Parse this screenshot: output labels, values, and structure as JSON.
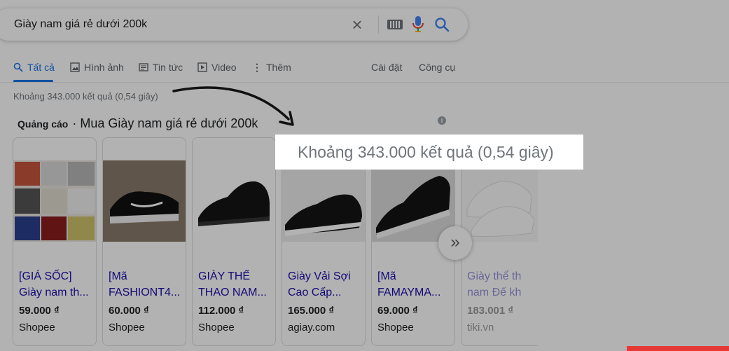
{
  "search": {
    "query": "Giày nam giá rẻ dưới 200k",
    "clear_icon": "close-icon",
    "keyboard_icon": "keyboard-icon",
    "mic_icon": "mic-icon",
    "search_icon": "search-icon"
  },
  "tabs": [
    {
      "label": "Tất cả",
      "icon": "search-icon",
      "active": true
    },
    {
      "label": "Hình ảnh",
      "icon": "image-icon"
    },
    {
      "label": "Tin tức",
      "icon": "news-icon"
    },
    {
      "label": "Video",
      "icon": "video-icon"
    },
    {
      "label": "Thêm",
      "icon": "more-vert-icon"
    },
    {
      "label": "Cài đặt"
    },
    {
      "label": "Công cụ"
    }
  ],
  "result_count": "Khoảng 343.000 kết quả (0,54 giây)",
  "ads": {
    "label": "Quảng cáo",
    "title": "· Mua Giày nam giá rẻ dưới 200k"
  },
  "products": [
    {
      "title_line1": "[GIÁ SỐC]",
      "title_line2": "Giày nam th...",
      "price": "59.000 ₫",
      "store": "Shopee"
    },
    {
      "title_line1": "[Mã",
      "title_line2": "FASHIONT4...",
      "price": "60.000 ₫",
      "store": "Shopee"
    },
    {
      "title_line1": "GIÀY THỂ",
      "title_line2": "THAO NAM...",
      "price": "112.000 ₫",
      "store": "Shopee"
    },
    {
      "title_line1": "Giày Vải Sợi",
      "title_line2": "Cao Cấp...",
      "price": "165.000 ₫",
      "store": "agiay.com"
    },
    {
      "title_line1": "[Mã",
      "title_line2": "FAMAYMA...",
      "price": "69.000 ₫",
      "store": "Shopee"
    },
    {
      "title_line1": "Giày thể th",
      "title_line2": "nam Đế kh",
      "price": "183.001 ₫",
      "store": "tiki.vn"
    }
  ],
  "next_label": "»",
  "highlight_text": "Khoảng 343.000 kết quả (0,54 giây)",
  "colors": {
    "accent": "#1a73e8",
    "link": "#1a0dab",
    "muted": "#70757a"
  }
}
